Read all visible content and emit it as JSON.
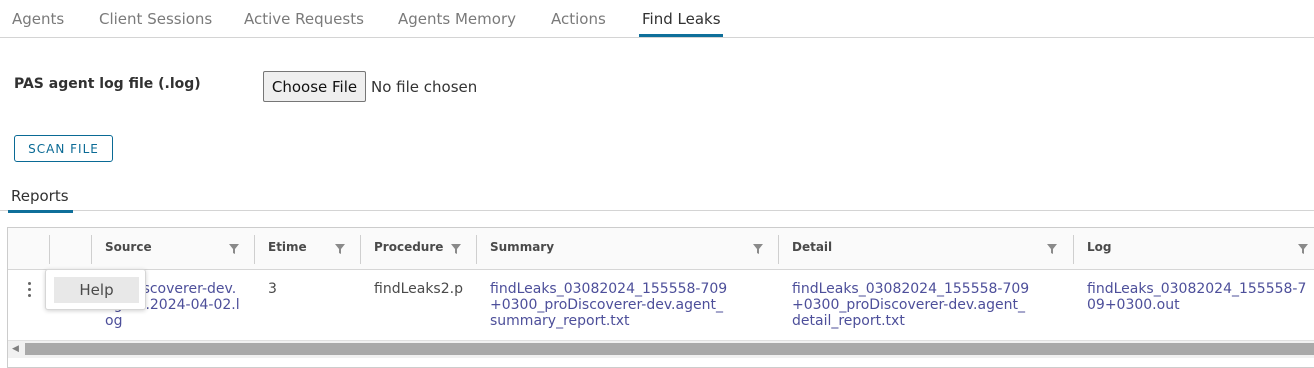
{
  "tabs": [
    "Agents",
    "Client Sessions",
    "Active Requests",
    "Agents Memory",
    "Actions",
    "Find Leaks"
  ],
  "active_tab": "Find Leaks",
  "form": {
    "log_label": "PAS agent log file (.log)",
    "choose_file_label": "Choose File",
    "file_status": "No file chosen",
    "scan_label": "SCAN FILE"
  },
  "reports_tab_label": "Reports",
  "table": {
    "columns": [
      "Source",
      "Etime",
      "Procedure",
      "Summary",
      "Detail",
      "Log"
    ],
    "rows": [
      {
        "source": "proDiscoverer-dev.agent.2024-04-02.log",
        "etime": "3",
        "procedure": "findLeaks2.p",
        "summary": "findLeaks_03082024_155558-709+0300_proDiscoverer-dev.agent_summary_report.txt",
        "detail": "findLeaks_03082024_155558-709+0300_proDiscoverer-dev.agent_detail_report.txt",
        "log": "findLeaks_03082024_155558-709+0300.out"
      }
    ]
  },
  "row_menu": {
    "items": [
      "Help"
    ]
  },
  "colors": {
    "accent": "#0f6f9a",
    "link": "#4d4f9a"
  }
}
